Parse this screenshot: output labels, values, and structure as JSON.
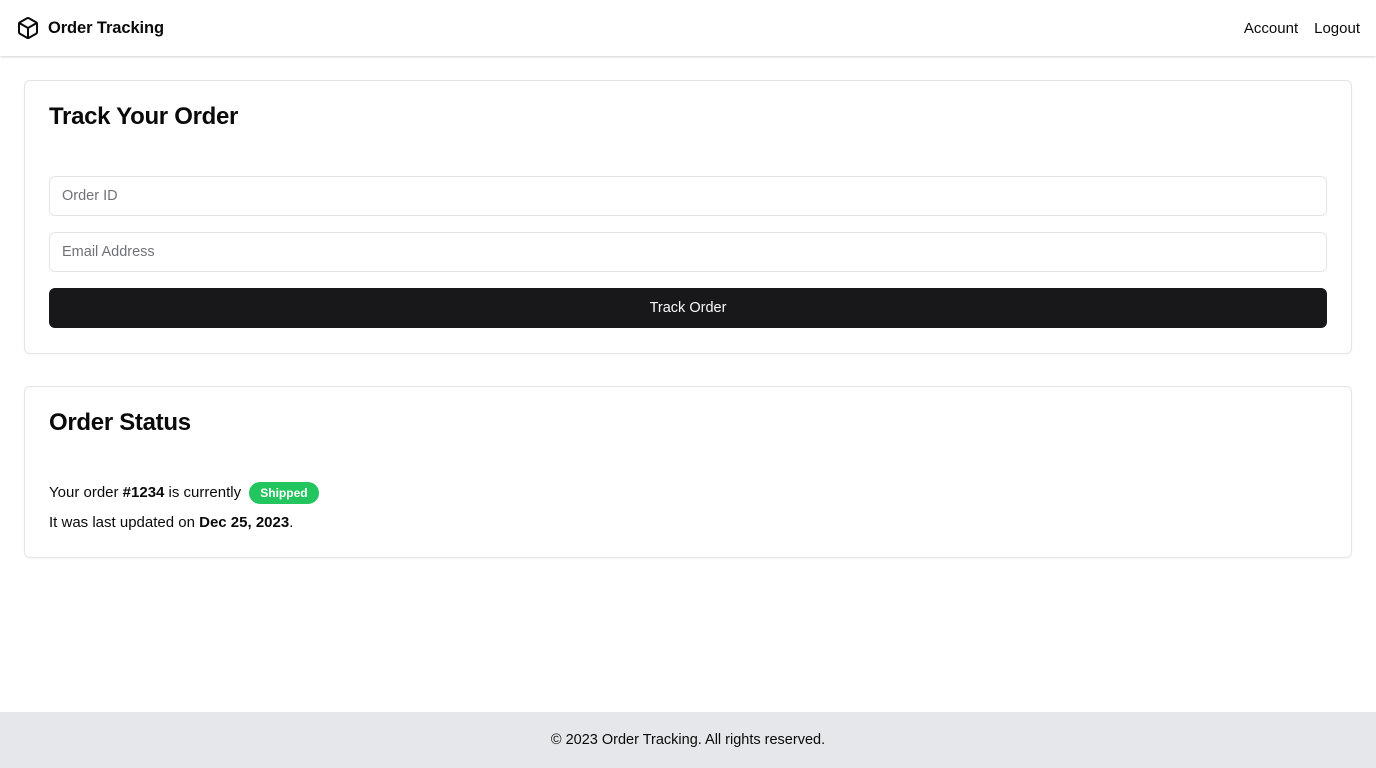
{
  "header": {
    "brand_icon": "package-icon",
    "brand_name": "Order Tracking",
    "nav": {
      "account": "Account",
      "logout": "Logout"
    }
  },
  "track_card": {
    "title": "Track Your Order",
    "order_id_placeholder": "Order ID",
    "order_id_value": "",
    "email_placeholder": "Email Address",
    "email_value": "",
    "submit_label": "Track Order"
  },
  "status_card": {
    "title": "Order Status",
    "line1_prefix": "Your order ",
    "order_number": "#1234",
    "line1_middle": " is currently ",
    "status_badge": "Shipped",
    "line2_prefix": "It was last updated on ",
    "updated_date": "Dec 25, 2023",
    "line2_suffix": "."
  },
  "footer": {
    "copyright": "© 2023 Order Tracking. All rights reserved."
  },
  "colors": {
    "primary_button": "#18181b",
    "status_shipped": "#22c55e",
    "footer_bg": "#e5e7eb",
    "border": "#e4e4e7"
  }
}
